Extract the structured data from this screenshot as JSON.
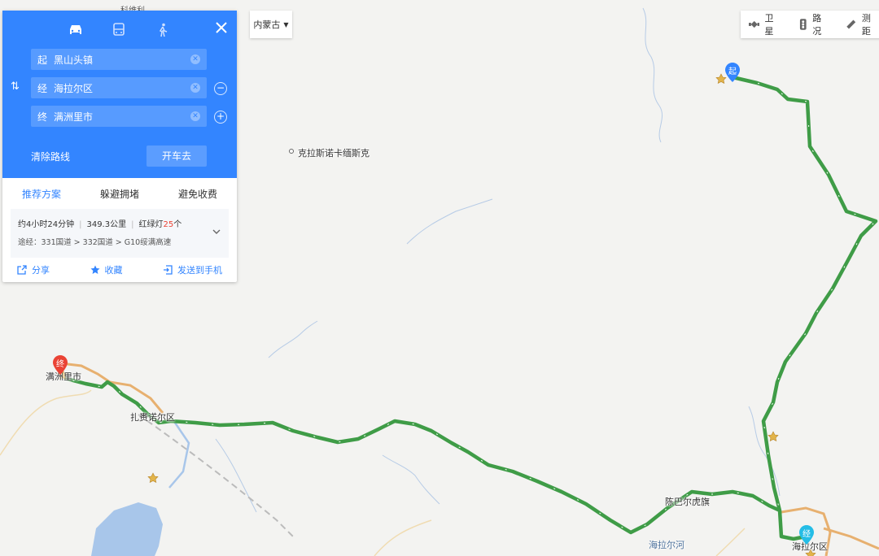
{
  "map": {
    "labels": {
      "top_edge": "科维利",
      "krasno": "克拉斯诺卡缅斯克",
      "zhalainuoer": "扎赉诺尔区",
      "manzhouli": "满洲里市",
      "chenbaerhu": "陈巴尔虎旗",
      "hailaer_river": "海拉尔河",
      "hailaer": "海拉尔区"
    },
    "markers": {
      "start": "起",
      "via": "经",
      "end": "终"
    },
    "colors": {
      "route": "#3f9c47",
      "road": "#e7b06f",
      "water": "#a8c6ea",
      "panel": "#3385ff"
    }
  },
  "panel": {
    "modes": [
      "car-icon",
      "bus-icon",
      "walk-icon"
    ],
    "start": {
      "tag": "起",
      "value": "黑山头镇"
    },
    "via": {
      "tag": "经",
      "value": "海拉尔区"
    },
    "end": {
      "tag": "终",
      "value": "满洲里市"
    },
    "clear_route": "清除路线",
    "drive": "开车去",
    "tabs": [
      "推荐方案",
      "躲避拥堵",
      "避免收费"
    ],
    "summary": {
      "duration": "约4小时24分钟",
      "distance": "349.3公里",
      "lights_label": "红绿灯",
      "lights_count": "25",
      "lights_unit": "个",
      "via_prefix": "途经：",
      "via_roads": "331国道 > 332国道 > G10绥满高速"
    },
    "actions": {
      "share": "分享",
      "favorite": "收藏",
      "send": "发送到手机"
    }
  },
  "region": {
    "label": "内蒙古"
  },
  "toolbar": {
    "satellite": "卫星",
    "traffic": "路况",
    "measure": "测距"
  }
}
